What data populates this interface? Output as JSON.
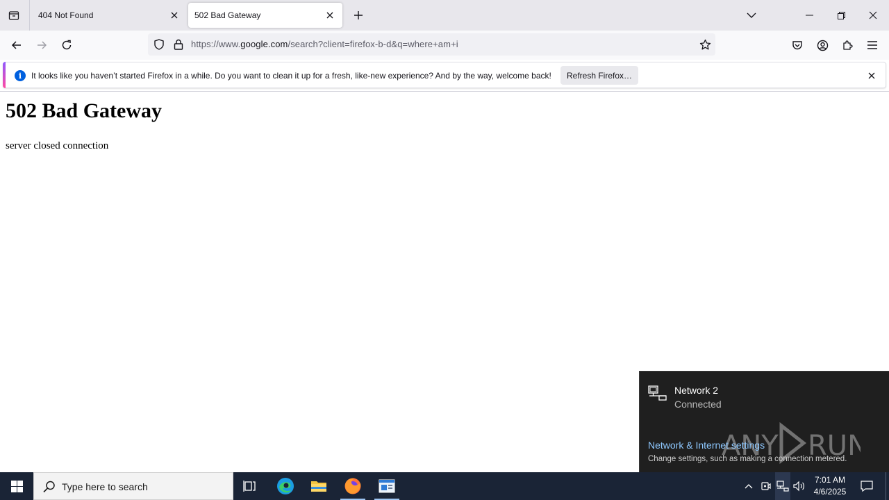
{
  "browser": {
    "tabs": [
      {
        "title": "404 Not Found",
        "active": false
      },
      {
        "title": "502 Bad Gateway",
        "active": true
      }
    ],
    "url": {
      "prefix": "https://www.",
      "domain": "google.com",
      "path": "/search?client=firefox-b-d&q=where+am+i"
    },
    "notification": {
      "message": "It looks like you haven’t started Firefox in a while. Do you want to clean it up for a fresh, like-new experience? And by the way, welcome back!",
      "button_label": "Refresh Firefox…"
    }
  },
  "page": {
    "heading": "502 Bad Gateway",
    "body": "server closed connection"
  },
  "network_flyout": {
    "network_name": "Network 2",
    "status": "Connected",
    "settings_link": "Network & Internet settings",
    "settings_desc": "Change settings, such as making a connection metered.",
    "watermark": "ANY RUN"
  },
  "taskbar": {
    "search_placeholder": "Type here to search",
    "time": "7:01 AM",
    "date": "4/6/2025"
  },
  "colors": {
    "accent_blue": "#0060df",
    "taskbar_bg": "#1a2436",
    "flyout_bg": "#1f1f1f",
    "link_blue": "#8ec8ff"
  }
}
